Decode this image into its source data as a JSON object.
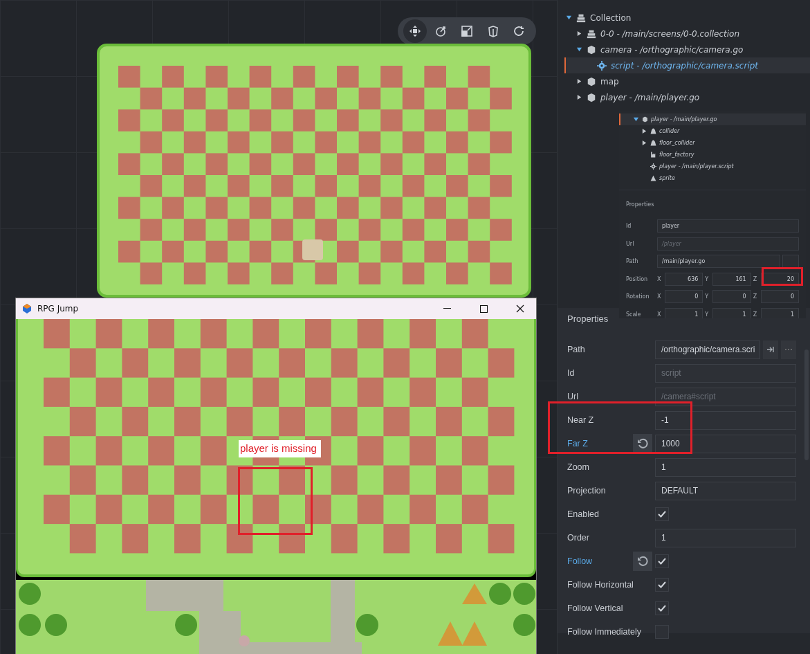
{
  "scene_toolbar": [
    {
      "kind": "move",
      "selected": true
    },
    {
      "kind": "rotate",
      "selected": false
    },
    {
      "kind": "scale",
      "selected": false
    },
    {
      "kind": "perspective",
      "selected": false
    },
    {
      "kind": "camera",
      "selected": false
    }
  ],
  "outline": [
    {
      "label": "Collection",
      "kind": "collection",
      "referenced": false,
      "expanded": true,
      "selected": false,
      "children": [
        {
          "label": "0-0 - /main/screens/0-0.collection",
          "kind": "collection",
          "referenced": true,
          "expanded": false,
          "selected": false
        },
        {
          "label": "camera - /orthographic/camera.go",
          "kind": "object",
          "referenced": true,
          "expanded": true,
          "selected": false,
          "children": [
            {
              "label": "script - /orthographic/camera.script",
              "kind": "script",
              "referenced": true,
              "selected": true
            }
          ]
        },
        {
          "label": "map",
          "kind": "object",
          "referenced": false,
          "expanded": false,
          "selected": false
        },
        {
          "label": "player - /main/player.go",
          "kind": "object",
          "referenced": true,
          "expanded": false,
          "selected": false
        }
      ]
    }
  ],
  "inset": {
    "outline": [
      {
        "label": "player - /main/player.go",
        "kind": "object",
        "referenced": true,
        "expanded": true,
        "selected": true,
        "children": [
          {
            "label": "collider",
            "kind": "collider",
            "referenced": true,
            "expanded": false,
            "selected": false
          },
          {
            "label": "floor_collider",
            "kind": "collider",
            "referenced": true,
            "expanded": false,
            "selected": false
          },
          {
            "label": "floor_factory",
            "kind": "factory",
            "referenced": true,
            "selected": false
          },
          {
            "label": "player - /main/player.script",
            "kind": "script",
            "referenced": true,
            "selected": false
          },
          {
            "label": "sprite",
            "kind": "sprite",
            "referenced": true,
            "selected": false
          }
        ]
      }
    ],
    "properties_title": "Properties",
    "rows": [
      {
        "label": "Id",
        "kind": "text",
        "value": "player",
        "disabled": false
      },
      {
        "label": "Url",
        "kind": "text",
        "value": "/player",
        "disabled": true
      },
      {
        "label": "Path",
        "kind": "path",
        "value": "/main/player.go",
        "disabled": false
      },
      {
        "label": "Position",
        "kind": "vector",
        "values": [
          {
            "axis": "X",
            "value": "636"
          },
          {
            "axis": "Y",
            "value": "161"
          },
          {
            "axis": "Z",
            "value": "20"
          }
        ]
      },
      {
        "label": "Rotation",
        "kind": "vector",
        "values": [
          {
            "axis": "X",
            "value": "0"
          },
          {
            "axis": "Y",
            "value": "0"
          },
          {
            "axis": "Z",
            "value": "0"
          }
        ]
      },
      {
        "label": "Scale",
        "kind": "vector",
        "values": [
          {
            "axis": "X",
            "value": "1"
          },
          {
            "axis": "Y",
            "value": "1"
          },
          {
            "axis": "Z",
            "value": "1"
          }
        ]
      }
    ]
  },
  "properties": {
    "title": "Properties",
    "rows": [
      {
        "label": "Path",
        "kind": "path",
        "value": "/orthographic/camera.scri",
        "overridden": false,
        "disabled": false
      },
      {
        "label": "Id",
        "kind": "text",
        "value": "script",
        "overridden": false,
        "disabled": true
      },
      {
        "label": "Url",
        "kind": "text",
        "value": "/camera#script",
        "overridden": false,
        "disabled": true
      },
      {
        "label": "Near Z",
        "kind": "text",
        "value": "-1",
        "overridden": false,
        "disabled": false
      },
      {
        "label": "Far Z",
        "kind": "text",
        "value": "1000",
        "overridden": true,
        "disabled": false
      },
      {
        "label": "Zoom",
        "kind": "text",
        "value": "1",
        "overridden": false,
        "disabled": false
      },
      {
        "label": "Projection",
        "kind": "text",
        "value": "DEFAULT",
        "overridden": false,
        "disabled": false
      },
      {
        "label": "Enabled",
        "kind": "checkbox",
        "checked": true,
        "overridden": false
      },
      {
        "label": "Order",
        "kind": "text",
        "value": "1",
        "overridden": false,
        "disabled": false
      },
      {
        "label": "Follow",
        "kind": "checkbox",
        "checked": true,
        "overridden": true
      },
      {
        "label": "Follow Horizontal",
        "kind": "checkbox",
        "checked": true,
        "overridden": false
      },
      {
        "label": "Follow Vertical",
        "kind": "checkbox",
        "checked": true,
        "overridden": false
      },
      {
        "label": "Follow Immediately",
        "kind": "checkbox",
        "checked": false,
        "overridden": false
      }
    ]
  },
  "game_window": {
    "title": "RPG Jump",
    "note": "player is missing"
  }
}
